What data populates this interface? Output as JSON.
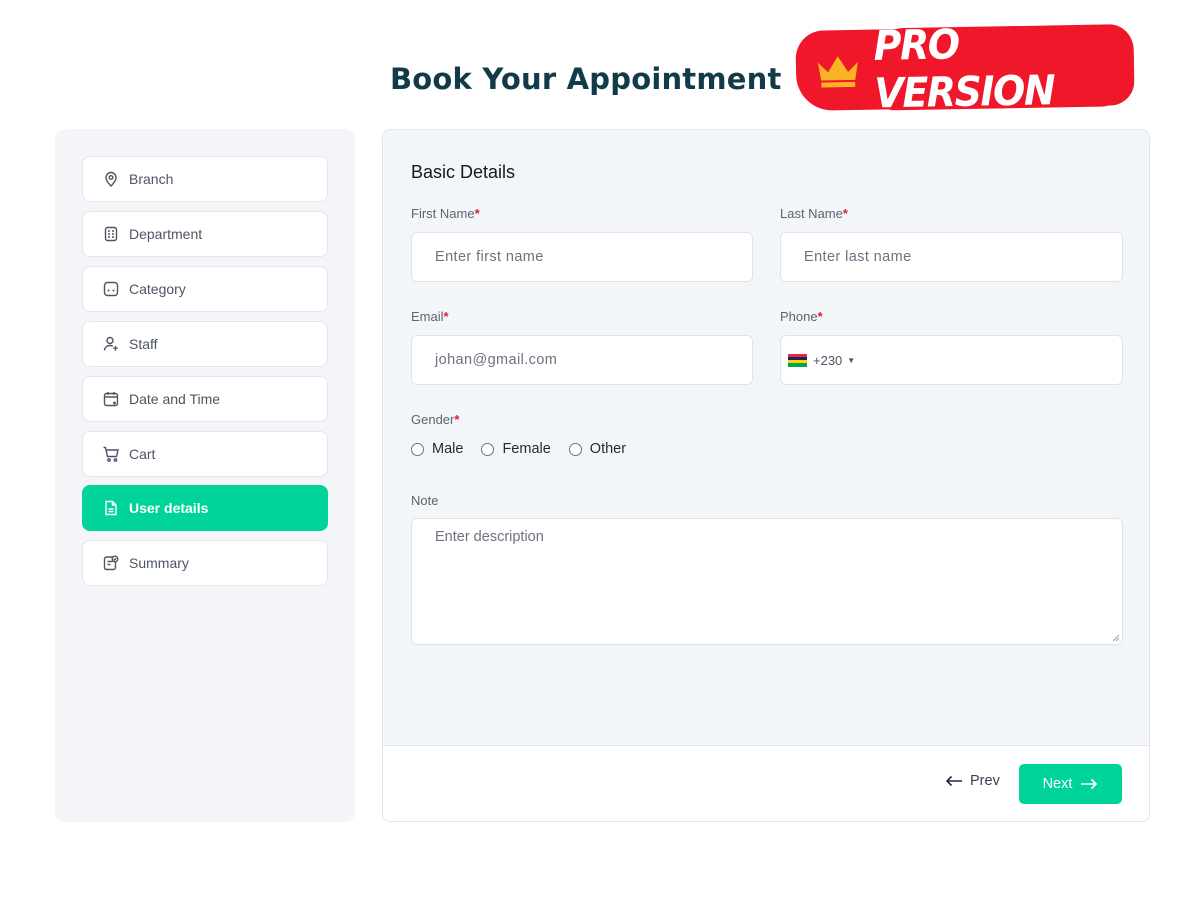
{
  "header": {
    "title": "Book Your Appointment",
    "badge_label": "PRO VERSION",
    "badge_icon": "crown-icon",
    "badge_color": "#f0172b"
  },
  "steps": [
    {
      "label": "Branch",
      "icon": "location-pin-icon"
    },
    {
      "label": "Department",
      "icon": "building-icon"
    },
    {
      "label": "Category",
      "icon": "category-icon"
    },
    {
      "label": "Staff",
      "icon": "user-add-icon"
    },
    {
      "label": "Date and Time",
      "icon": "calendar-icon"
    },
    {
      "label": "Cart",
      "icon": "cart-icon"
    },
    {
      "label": "User details",
      "icon": "document-icon",
      "active": true
    },
    {
      "label": "Summary",
      "icon": "clipboard-check-icon"
    }
  ],
  "form": {
    "section_title": "Basic Details",
    "first_name": {
      "label": "First Name",
      "required": "*",
      "placeholder": "Enter first name"
    },
    "last_name": {
      "label": "Last Name",
      "required": "*",
      "placeholder": "Enter last name"
    },
    "email": {
      "label": "Email",
      "required": "*",
      "placeholder": "johan@gmail.com"
    },
    "phone": {
      "label": "Phone",
      "required": "*",
      "dial_code": "+230",
      "country_flag": "flag-mauritius-icon"
    },
    "gender": {
      "label": "Gender",
      "required": "*",
      "options": [
        "Male",
        "Female",
        "Other"
      ]
    },
    "note": {
      "label": "Note",
      "placeholder": "Enter description"
    }
  },
  "footer": {
    "prev_label": "Prev",
    "next_label": "Next"
  },
  "colors": {
    "accent": "#00d49a",
    "title": "#123b4a",
    "required": "#e11d2e"
  }
}
